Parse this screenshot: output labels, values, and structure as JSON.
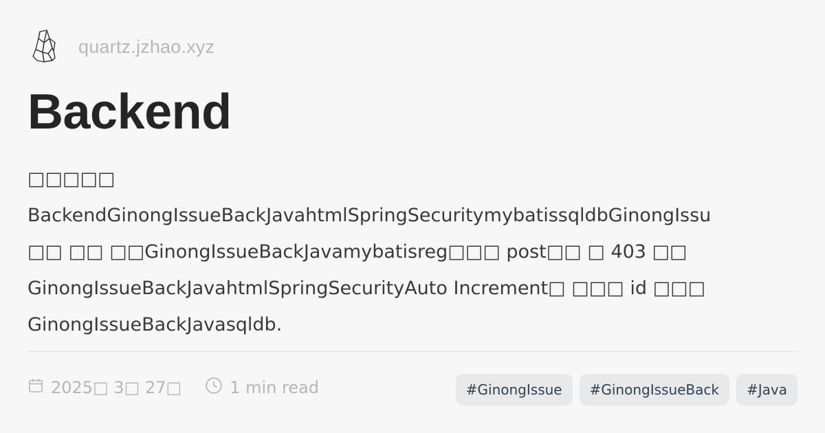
{
  "header": {
    "logo_icon": "crystal-logo-icon",
    "site_name": "quartz.jzhao.xyz"
  },
  "title": "Backend",
  "description": "□□□□□\nBackendGinongIssueBackJavahtmlSpringSecuritymybatissqldbGinongIssu\n□□ □□ □□GinongIssueBackJavamybatisreg□□□ post□□ □ 403 □□\nGinongIssueBackJavahtmlSpringSecurityAuto Increment□ □□□ id □□□\nGinongIssueBackJavasqldb.",
  "meta": {
    "date_icon": "calendar-icon",
    "date": "2025□ 3□ 27□",
    "read_icon": "clock-icon",
    "read_time": "1 min read"
  },
  "tags": [
    "#GinongIssue",
    "#GinongIssueBack",
    "#Java"
  ],
  "colors": {
    "background": "#f7f7f8",
    "title": "#252525",
    "muted": "#b5b5bb",
    "tag_bg": "#e8e9eb",
    "tag_text": "#2f4150"
  }
}
